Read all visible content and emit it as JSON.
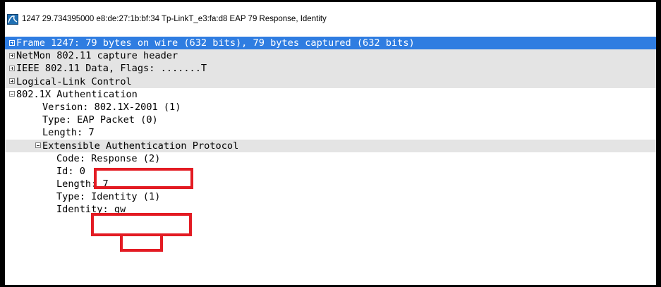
{
  "title": {
    "text": "1247 29.734395000 e8:de:27:1b:bf:34 Tp-LinkT_e3:fa:d8 EAP 79 Response, Identity"
  },
  "tree": [
    {
      "label": "Frame 1247: 79 bytes on wire (632 bits), 79 bytes captured (632 bits)",
      "expander": "plus",
      "selected": true
    },
    {
      "label": "NetMon 802.11 capture header",
      "expander": "plus"
    },
    {
      "label": "IEEE 802.11 Data, Flags: .......T",
      "expander": "plus"
    },
    {
      "label": "Logical-Link Control",
      "expander": "plus"
    },
    {
      "label": "802.1X Authentication",
      "expander": "minus"
    },
    {
      "label": "Version: 802.1X-2001 (1)"
    },
    {
      "label": "Type: EAP Packet (0)"
    },
    {
      "label": "Length: 7"
    },
    {
      "label": "Extensible Authentication Protocol",
      "expander": "minus"
    },
    {
      "label": "Code: Response (2)"
    },
    {
      "label": "Id: 0"
    },
    {
      "label": "Length: 7"
    },
    {
      "label": "Type: Identity (1)"
    },
    {
      "label": "Identity: qw"
    }
  ],
  "colors": {
    "selection": "#2f7de1",
    "shade": "#e4e4e4",
    "highlight": "#e31b23"
  }
}
